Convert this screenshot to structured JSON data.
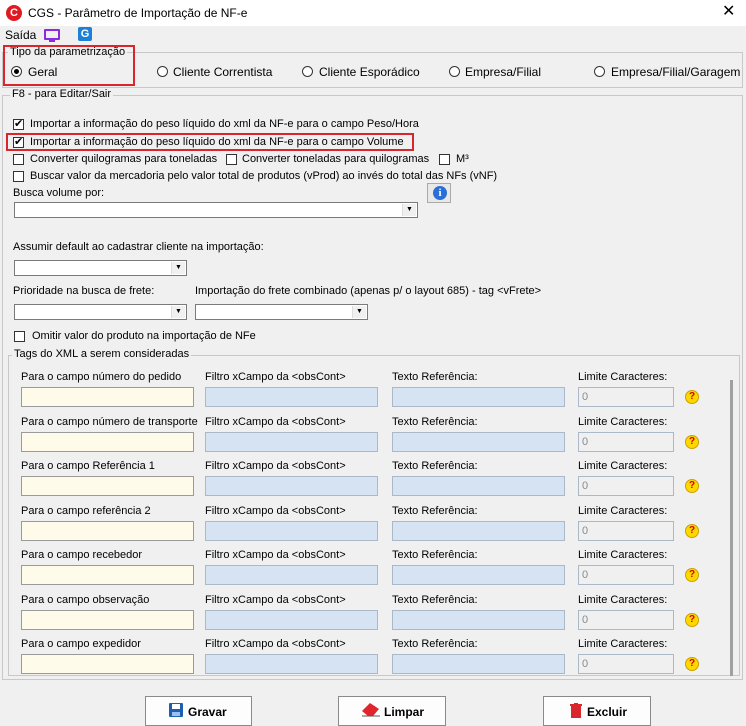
{
  "window": {
    "title": "CGS - Parâmetro de Importação de NF-e",
    "app_icon_letter": "C",
    "close": "✕"
  },
  "menu": {
    "saida": "Saída",
    "g_icon_letter": "G"
  },
  "param_type": {
    "legend": "Tipo da parametrização",
    "options": [
      "Geral",
      "Cliente Correntista",
      "Cliente Esporádico",
      "Empresa/Filial",
      "Empresa/Filial/Garagem"
    ],
    "selected": "Geral"
  },
  "edit_group": {
    "legend": "F8 - para Editar/Sair"
  },
  "checks": {
    "peso_hora": "Importar a informação do peso líquido do xml da NF-e para o campo Peso/Hora",
    "volume": "Importar a informação do peso líquido do xml da NF-e para o campo Volume",
    "kg_ton": "Converter quilogramas para toneladas",
    "ton_kg": "Converter toneladas para quilogramas",
    "m3": "M³",
    "vprod": "Buscar valor da mercadoria pelo valor total de produtos (vProd) ao invés do total das NFs (vNF)",
    "omitir": "Omitir valor do produto na importação de NFe"
  },
  "labels": {
    "busca_volume": "Busca volume por:",
    "assumir_default": "Assumir default ao cadastrar cliente na importação:",
    "prioridade_frete": "Prioridade na busca de frete:",
    "frete_combinado": "Importação do frete combinado (apenas p/ o layout 685) - tag <vFrete>"
  },
  "tags": {
    "legend": "Tags do XML a serem consideradas",
    "col_filtro": "Filtro xCampo da <obsCont>",
    "col_texto": "Texto Referência:",
    "col_limite": "Limite Caracteres:",
    "rows": [
      {
        "label": "Para o campo número do pedido",
        "limit": "0"
      },
      {
        "label": "Para o campo número de transporte",
        "limit": "0"
      },
      {
        "label": "Para o campo Referência 1",
        "limit": "0"
      },
      {
        "label": "Para o campo referência 2",
        "limit": "0"
      },
      {
        "label": "Para o campo recebedor",
        "limit": "0"
      },
      {
        "label": "Para o campo observação",
        "limit": "0"
      },
      {
        "label": "Para o campo expedidor",
        "limit": "0"
      }
    ]
  },
  "buttons": {
    "gravar": "Gravar",
    "limpar": "Limpar",
    "excluir": "Excluir"
  },
  "colors": {
    "highlight": "#d9262c",
    "input_blue": "#d5e3f3",
    "input_yellow": "#fffbea"
  }
}
